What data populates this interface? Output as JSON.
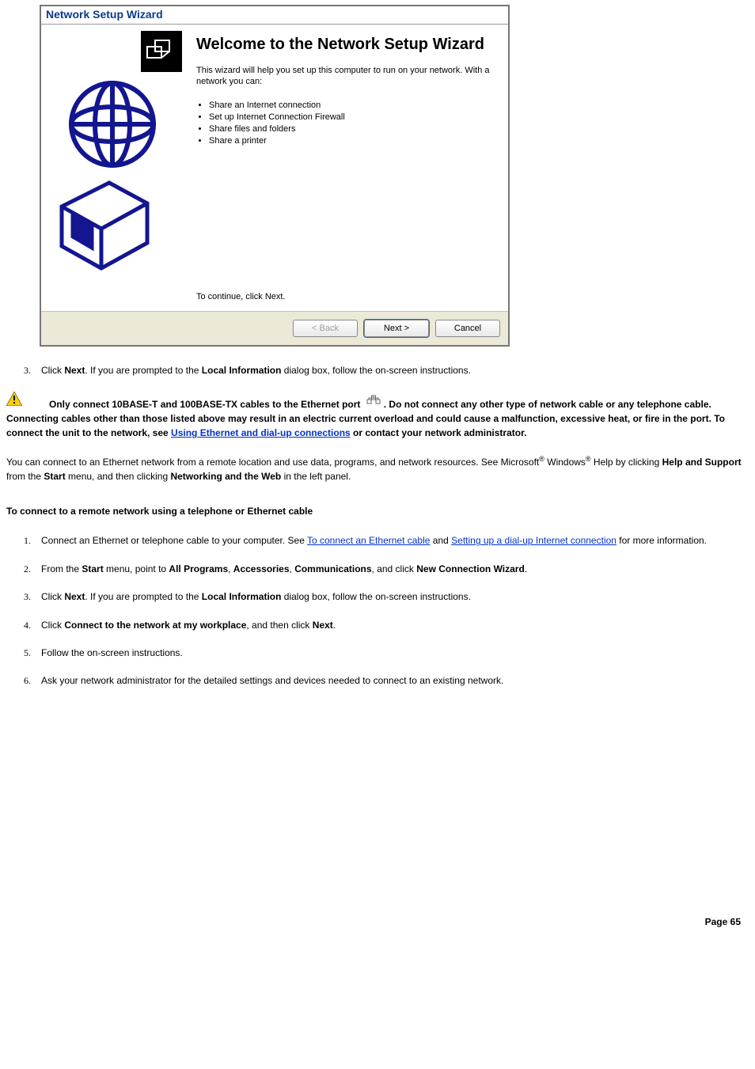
{
  "wizard": {
    "title": "Network Setup Wizard",
    "heading": "Welcome to the Network Setup Wizard",
    "intro": "This wizard will help you set up this computer to run on your network. With a network you can:",
    "bullets": [
      "Share an Internet connection",
      "Set up Internet Connection Firewall",
      "Share files and folders",
      "Share a printer"
    ],
    "continue": "To continue, click Next.",
    "buttons": {
      "back": "< Back",
      "next": "Next >",
      "cancel": "Cancel"
    }
  },
  "step3": {
    "num": "3.",
    "pre": "Click ",
    "b1": "Next",
    "mid": ". If you are prompted to the ",
    "b2": "Local Information",
    "post": " dialog box, follow the on-screen instructions."
  },
  "caution": {
    "s1": "Only connect 10BASE-T and 100BASE-TX cables to the Ethernet port ",
    "s2": ". Do not connect any other type of network cable or any telephone cable. Connecting cables other than those listed above may result in an electric current overload and could cause a malfunction, excessive heat, or fire in the port. To connect the unit to the network, see ",
    "link": "Using Ethernet and dial-up connections",
    "s3": " or contact your network administrator."
  },
  "para": {
    "t1": "You can connect to an Ethernet network from a remote location and use data, programs, and network resources. See Microsoft",
    "reg1": "®",
    "t2": " Windows",
    "reg2": "®",
    "t3": " Help by clicking ",
    "b1": "Help and Support",
    "t4": " from the ",
    "b2": "Start",
    "t5": " menu, and then clicking ",
    "b3": "Networking and the Web",
    "t6": " in the left panel."
  },
  "subhead": "To connect to a remote network using a telephone or Ethernet cable",
  "list2": {
    "i1": {
      "num": "1.",
      "t1": "Connect an Ethernet or telephone cable to your computer. See ",
      "link1": "To connect an Ethernet cable",
      "t2": " and ",
      "link2": "Setting up a dial-up Internet connection",
      "t3": " for more information."
    },
    "i2": {
      "num": "2.",
      "t1": "From the ",
      "b1": "Start",
      "t2": " menu, point to ",
      "b2": "All Programs",
      "t3": ", ",
      "b3": "Accessories",
      "t4": ", ",
      "b4": "Communications",
      "t5": ", and click ",
      "b5": "New Connection Wizard",
      "t6": "."
    },
    "i3": {
      "num": "3.",
      "t1": "Click ",
      "b1": "Next",
      "t2": ". If you are prompted to the ",
      "b2": "Local Information",
      "t3": " dialog box, follow the on-screen instructions."
    },
    "i4": {
      "num": "4.",
      "t1": "Click ",
      "b1": "Connect to the network at my workplace",
      "t2": ", and then click ",
      "b2": "Next",
      "t3": "."
    },
    "i5": {
      "num": "5.",
      "t1": "Follow the on-screen instructions."
    },
    "i6": {
      "num": "6.",
      "t1": "Ask your network administrator for the detailed settings and devices needed to connect to an existing network."
    }
  },
  "footer": "Page 65"
}
